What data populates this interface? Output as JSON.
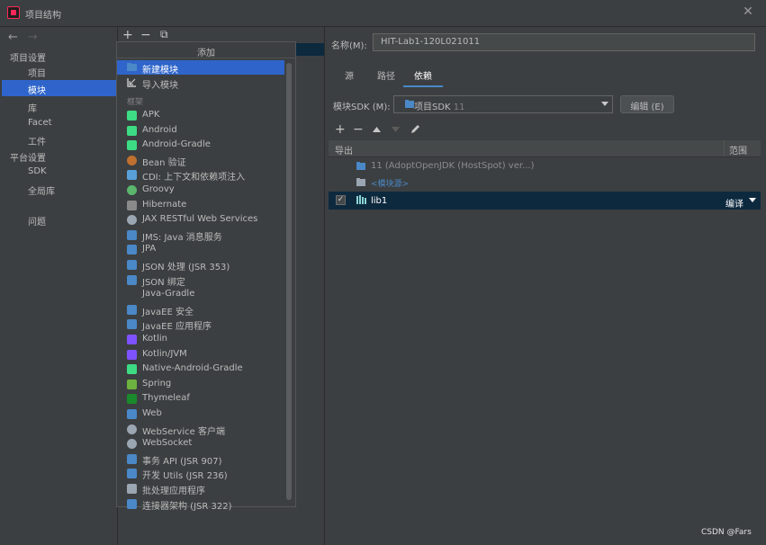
{
  "window": {
    "title": "项目结构"
  },
  "left_nav": {
    "section_project": "项目设置",
    "items_project": [
      "项目",
      "模块",
      "库",
      "Facet",
      "工件"
    ],
    "section_platform": "平台设置",
    "items_platform": [
      "SDK",
      "全局库"
    ],
    "item_problems": "问题",
    "selected": "模块"
  },
  "popup": {
    "title": "添加",
    "top_items": [
      "新建模块",
      "导入模块"
    ],
    "group_label": "框架",
    "framework_items": [
      {
        "label": "APK",
        "icon": "android-icon",
        "color": "#3ddc84"
      },
      {
        "label": "Android",
        "icon": "android-icon",
        "color": "#3ddc84"
      },
      {
        "label": "Android-Gradle",
        "icon": "android-icon",
        "color": "#3ddc84"
      },
      {
        "label": "Bean 验证",
        "icon": "bean-icon",
        "color": "#c0702f"
      },
      {
        "label": "CDI: 上下文和依赖项注入",
        "icon": "cdi-icon",
        "color": "#5aa0d8"
      },
      {
        "label": "Groovy",
        "icon": "groovy-icon",
        "color": "#5bb56d"
      },
      {
        "label": "Hibernate",
        "icon": "hibernate-icon",
        "color": "#8a8a8a"
      },
      {
        "label": "JAX RESTful Web Services",
        "icon": "globe-icon",
        "color": "#9aa6b2"
      },
      {
        "label": "JMS: Java 消息服务",
        "icon": "jms-icon",
        "color": "#4a88c7"
      },
      {
        "label": "JPA",
        "icon": "jpa-icon",
        "color": "#4a88c7"
      },
      {
        "label": "JSON 处理 (JSR 353)",
        "icon": "json-icon",
        "color": "#4a88c7"
      },
      {
        "label": "JSON 绑定",
        "icon": "json-icon",
        "color": "#4a88c7"
      },
      {
        "label": "Java-Gradle",
        "icon": "",
        "color": ""
      },
      {
        "label": "JavaEE 安全",
        "icon": "javaee-icon",
        "color": "#4a88c7"
      },
      {
        "label": "JavaEE 应用程序",
        "icon": "javaee-icon",
        "color": "#4a88c7"
      },
      {
        "label": "Kotlin",
        "icon": "kotlin-icon",
        "color": "#7f52ff"
      },
      {
        "label": "Kotlin/JVM",
        "icon": "kotlin-icon",
        "color": "#7f52ff"
      },
      {
        "label": "Native-Android-Gradle",
        "icon": "android-icon",
        "color": "#3ddc84"
      },
      {
        "label": "Spring",
        "icon": "spring-icon",
        "color": "#6db33f"
      },
      {
        "label": "Thymeleaf",
        "icon": "thymeleaf-icon",
        "color": "#1b8a2c"
      },
      {
        "label": "Web",
        "icon": "web-icon",
        "color": "#4a88c7"
      },
      {
        "label": "WebService 客户端",
        "icon": "globe-icon",
        "color": "#9aa6b2"
      },
      {
        "label": "WebSocket",
        "icon": "websocket-icon",
        "color": "#9aa6b2"
      },
      {
        "label": "事务 API (JSR 907)",
        "icon": "transaction-icon",
        "color": "#4a88c7"
      },
      {
        "label": "开发 Utils (JSR 236)",
        "icon": "utils-icon",
        "color": "#4a88c7"
      },
      {
        "label": "批处理应用程序",
        "icon": "batch-icon",
        "color": "#9aa6b2"
      },
      {
        "label": "连接器架构 (JSR 322)",
        "icon": "connector-icon",
        "color": "#4a88c7"
      }
    ]
  },
  "right": {
    "name_label": "名称(M):",
    "name_value": "HIT-Lab1-120L021011",
    "tabs": [
      "源",
      "路径",
      "依赖"
    ],
    "active_tab": "依赖",
    "sdk_label": "模块SDK (M):",
    "sdk_value": "项目SDK",
    "sdk_hint": "11",
    "edit_button": "编辑 (E)",
    "table_headers": {
      "export": "导出",
      "scope": "范围"
    },
    "deps": {
      "sdk": "11 (AdoptOpenJDK (HostSpot) ver...)",
      "source": "<模块源>",
      "lib": "lib1",
      "lib_scope": "编译"
    }
  },
  "watermark": "CSDN @Fars"
}
